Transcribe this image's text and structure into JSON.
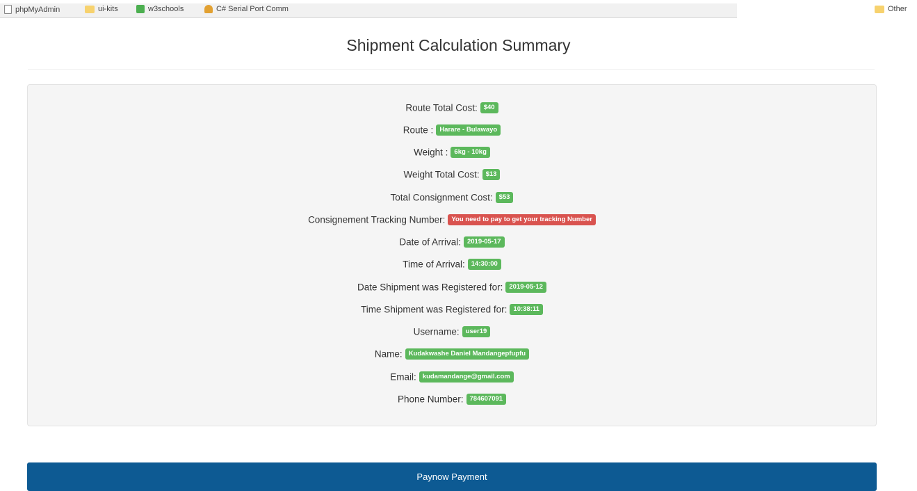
{
  "bookmarks": [
    {
      "label": "phpMyAdmin",
      "icon": "page-icon"
    },
    {
      "label": "ui-kits",
      "icon": "folder-icon"
    },
    {
      "label": "w3schools",
      "icon": "w3schools-icon"
    },
    {
      "label": "C# Serial Port Comm",
      "icon": "csharp-icon"
    }
  ],
  "bookmarks_other": "Other",
  "page_title": "Shipment Calculation Summary",
  "summary": [
    {
      "label": "Route Total Cost:",
      "value": "$40",
      "status": "green"
    },
    {
      "label": "Route :",
      "value": "Harare - Bulawayo",
      "status": "green"
    },
    {
      "label": "Weight :",
      "value": "6kg - 10kg",
      "status": "green"
    },
    {
      "label": "Weight Total Cost:",
      "value": "$13",
      "status": "green"
    },
    {
      "label": "Total Consignment Cost:",
      "value": "$53",
      "status": "green"
    },
    {
      "label": "Consignement Tracking Number:",
      "value": "You need to pay to get your tracking Number",
      "status": "red"
    },
    {
      "label": "Date of Arrival:",
      "value": "2019-05-17",
      "status": "green"
    },
    {
      "label": "Time of Arrival:",
      "value": "14:30:00",
      "status": "green"
    },
    {
      "label": "Date Shipment was Registered for:",
      "value": "2019-05-12",
      "status": "green"
    },
    {
      "label": "Time Shipment was Registered for:",
      "value": "10:38:11",
      "status": "green"
    },
    {
      "label": "Username:",
      "value": "user19",
      "status": "green"
    },
    {
      "label": "Name:",
      "value": "Kudakwashe Daniel Mandangepfupfu",
      "status": "green"
    },
    {
      "label": "Email:",
      "value": "kudamandange@gmail.com",
      "status": "green"
    },
    {
      "label": "Phone Number:",
      "value": "784607091",
      "status": "green"
    }
  ],
  "colors": {
    "green": "#5cb85c",
    "red": "#d9534f",
    "button": "#0d5a93"
  },
  "pay_button_label": "Paynow Payment"
}
